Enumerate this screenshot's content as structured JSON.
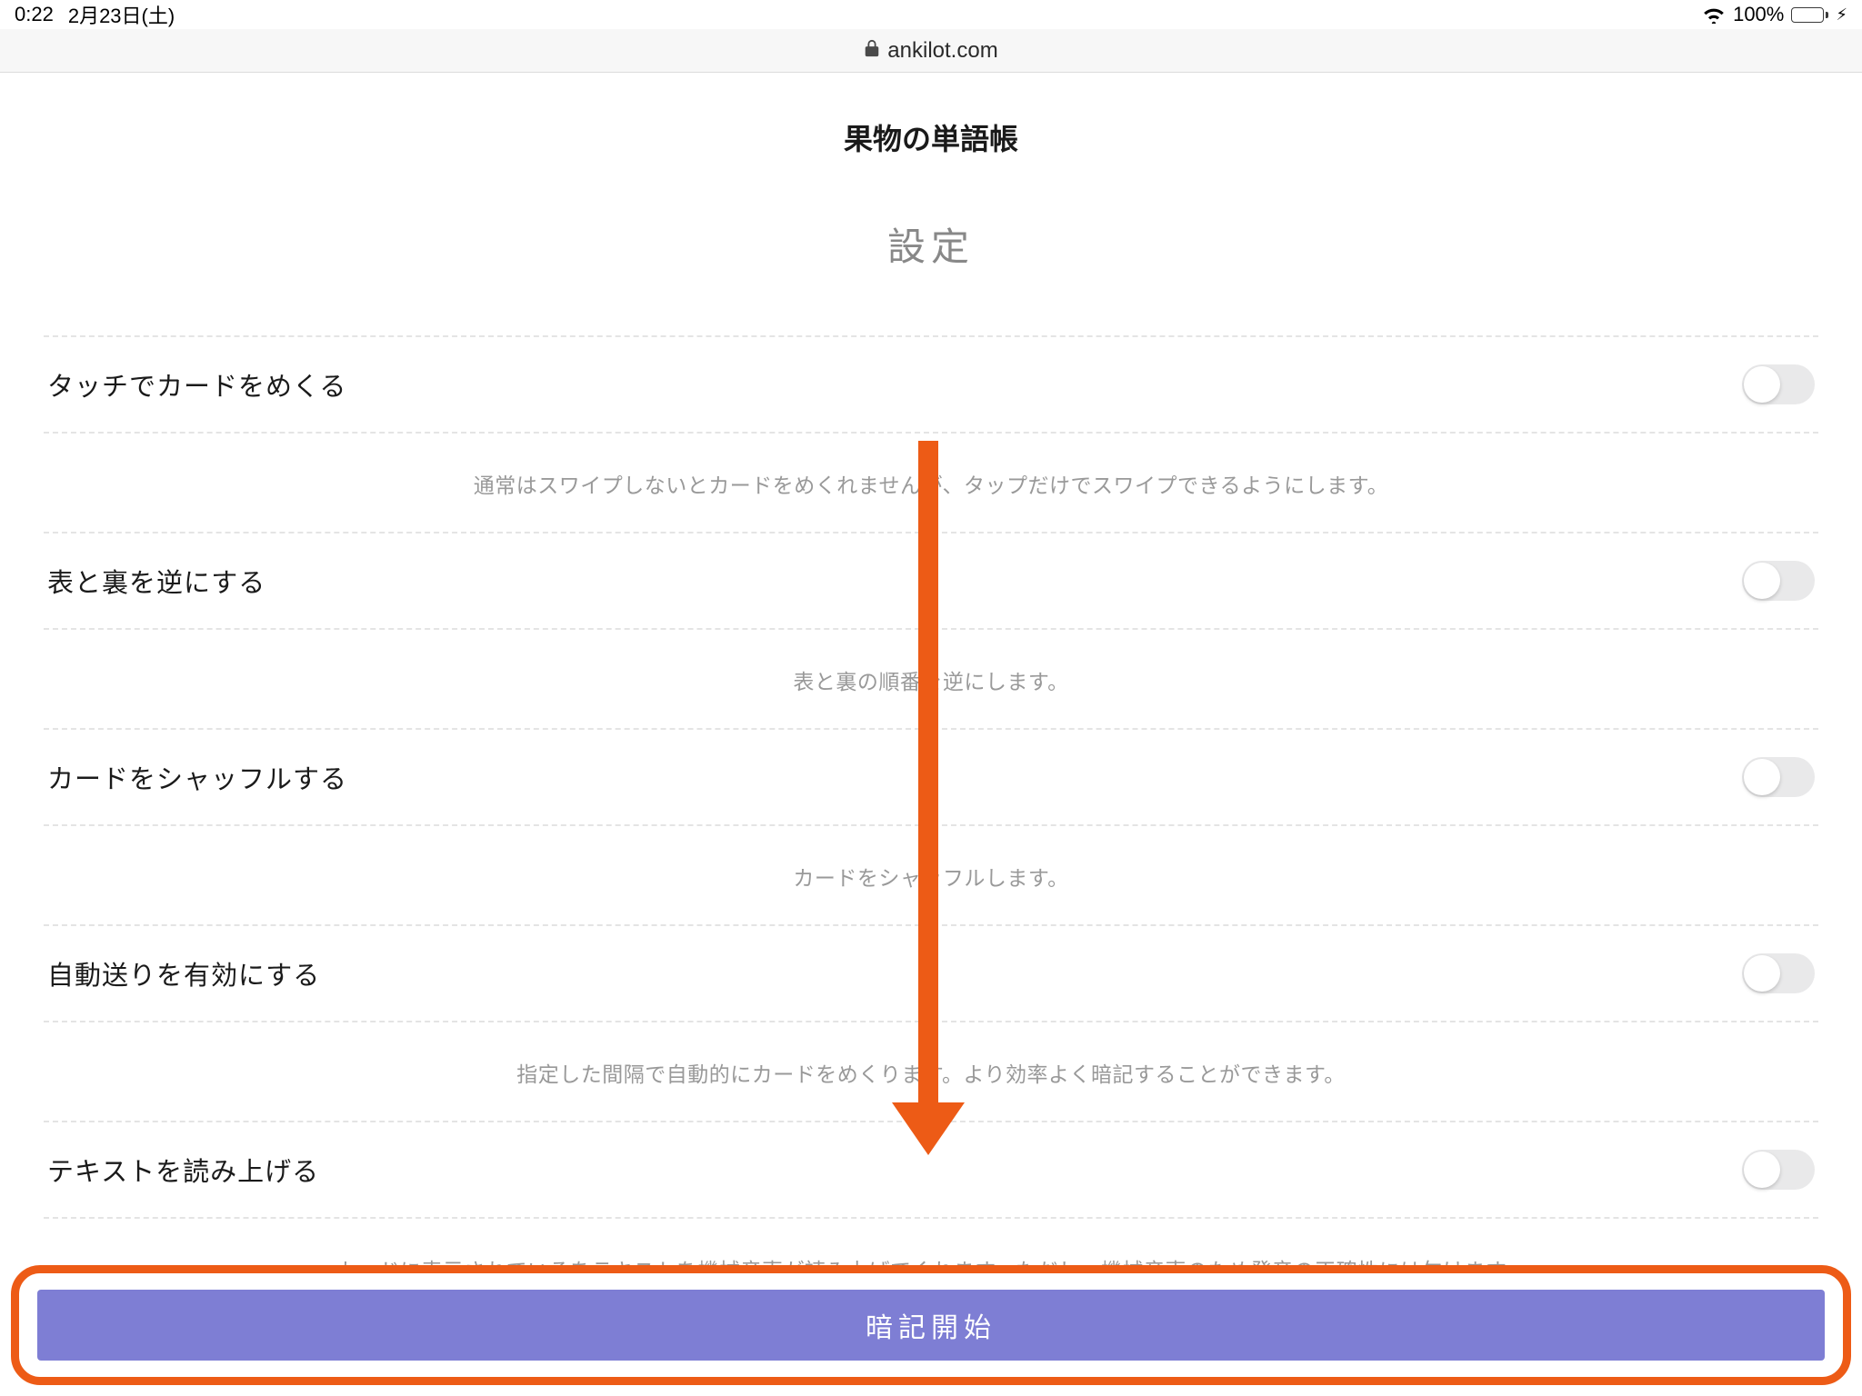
{
  "statusBar": {
    "time": "0:22",
    "date": "2月23日(土)",
    "batteryPercent": "100%"
  },
  "addressBar": {
    "domain": "ankilot.com"
  },
  "page": {
    "title": "果物の単語帳",
    "settingsHeading": "設定"
  },
  "settings": [
    {
      "label": "タッチでカードをめくる",
      "desc": "通常はスワイプしないとカードをめくれませんが、タップだけでスワイプできるようにします。"
    },
    {
      "label": "表と裏を逆にする",
      "desc": "表と裏の順番を逆にします。"
    },
    {
      "label": "カードをシャッフルする",
      "desc": "カードをシャッフルします。"
    },
    {
      "label": "自動送りを有効にする",
      "desc": "指定した間隔で自動的にカードをめくります。より効率よく暗記することができます。"
    },
    {
      "label": "テキストを読み上げる",
      "desc": "カードに表示されているをテキストを機械音声が読み上げてくれます。ただし、機械音声のため発音の正確性には欠けます。"
    }
  ],
  "button": {
    "start": "暗記開始"
  }
}
